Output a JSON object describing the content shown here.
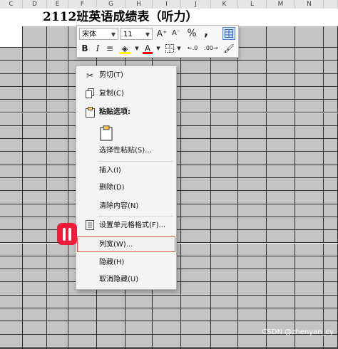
{
  "columns": [
    "C",
    "D",
    "E",
    "F",
    "G",
    "H",
    "I",
    "J",
    "K",
    "L",
    "M",
    "N"
  ],
  "sheet_title": "2112班英语成绩表（听力）",
  "toolbar": {
    "font_name": "宋体",
    "font_size": "11",
    "grow_font": "A⁺",
    "shrink_font": "A⁻",
    "percent": "%",
    "comma": ",",
    "bold": "B",
    "italic": "I",
    "align": "≡",
    "font_color_letter": "A",
    "fill_color": "#ffff00",
    "font_color": "#ff0000",
    "increase_decimal": "←.0",
    "decrease_decimal": ".00→"
  },
  "context_menu": {
    "cut": "剪切(T)",
    "copy": "复制(C)",
    "paste_options": "粘贴选项:",
    "paste_special": "选择性粘贴(S)...",
    "insert": "插入(I)",
    "delete": "删除(D)",
    "clear_contents": "清除内容(N)",
    "format_cells": "设置单元格格式(F)...",
    "column_width": "列宽(W)...",
    "hide": "隐藏(H)",
    "unhide": "取消隐藏(U)"
  },
  "watermark": "CSDN @zhenyan_cy",
  "colors": {
    "cell_gray": "#c3c3c3",
    "grid_line": "#2a2a2a",
    "annotation_red": "#ee1b3a",
    "highlight_border": "#d9534f"
  }
}
